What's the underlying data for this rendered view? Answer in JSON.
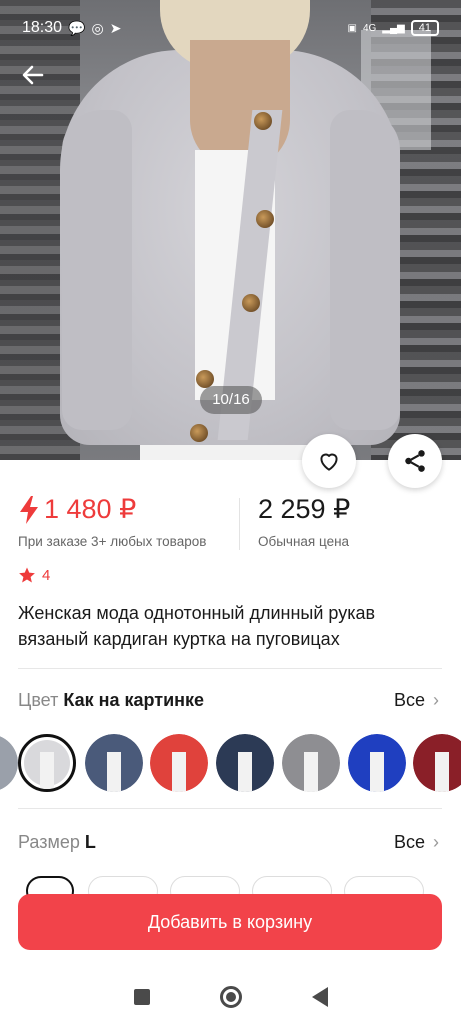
{
  "status_bar": {
    "time": "18:30",
    "network": "4G",
    "battery": "41"
  },
  "gallery": {
    "counter": "10/16"
  },
  "price": {
    "current": "1 480 ₽",
    "current_note": "При заказе 3+ любых товаров",
    "regular": "2 259 ₽",
    "regular_note": "Обычная цена"
  },
  "rating": {
    "value": "4"
  },
  "product": {
    "title": "Женская мода однотонный длинный рукав вязаный кардиган куртка на пуговицах"
  },
  "color_row": {
    "label": "Цвет",
    "value": "Как на картинке",
    "all": "Все",
    "swatches": [
      {
        "color": "#9aa0aa"
      },
      {
        "color": "#d9d9dc",
        "selected": true
      },
      {
        "color": "#4a5a7a"
      },
      {
        "color": "#e0423c"
      },
      {
        "color": "#2c3a55"
      },
      {
        "color": "#8e8e92"
      },
      {
        "color": "#1f3fc0"
      },
      {
        "color": "#8a1f28"
      }
    ]
  },
  "size_row": {
    "label": "Размер",
    "value": "L",
    "all": "Все"
  },
  "cart": {
    "label": "Добавить в корзину"
  },
  "colors": {
    "accent": "#f2434a",
    "price": "#ee3b3b"
  }
}
